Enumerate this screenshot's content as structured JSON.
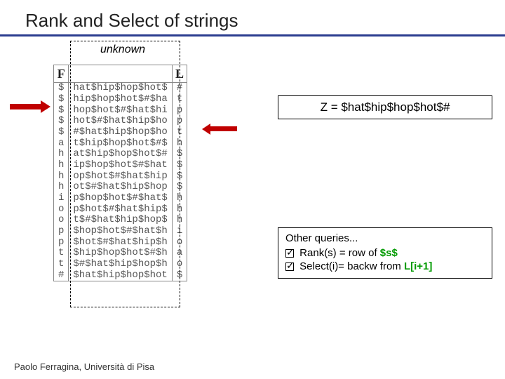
{
  "title": "Rank and Select of strings",
  "unknown_label": "unknown",
  "z_label": "Z = $hat$hip$hop$hot$#",
  "queries": {
    "heading": "Other queries...",
    "rank_prefix": "Rank(s)  = row of ",
    "rank_suffix": "$s$",
    "select_prefix": "Select(i)= backw from ",
    "select_suffix": "L[i+1]"
  },
  "footer": "Paolo Ferragina, Università di Pisa",
  "headers": {
    "F": "F",
    "L": "L"
  },
  "rows": [
    {
      "f": "$",
      "m": "hat$hip$hop$hot$",
      "l": "#"
    },
    {
      "f": "$",
      "m": "hip$hop$hot$#$ha",
      "l": "t"
    },
    {
      "f": "$",
      "m": "hop$hot$#$hat$hi",
      "l": "p"
    },
    {
      "f": "$",
      "m": "hot$#$hat$hip$ho",
      "l": "p"
    },
    {
      "f": "$",
      "m": "#$hat$hip$hop$ho",
      "l": "t"
    },
    {
      "f": "a",
      "m": "t$hip$hop$hot$#$",
      "l": "h"
    },
    {
      "f": "h",
      "m": "at$hip$hop$hot$#",
      "l": "$"
    },
    {
      "f": "h",
      "m": "ip$hop$hot$#$hat",
      "l": "$"
    },
    {
      "f": "h",
      "m": "op$hot$#$hat$hip",
      "l": "$"
    },
    {
      "f": "h",
      "m": "ot$#$hat$hip$hop",
      "l": "$"
    },
    {
      "f": "i",
      "m": "p$hop$hot$#$hat$",
      "l": "h"
    },
    {
      "f": "o",
      "m": "p$hot$#$hat$hip$",
      "l": "h"
    },
    {
      "f": "o",
      "m": "t$#$hat$hip$hop$",
      "l": "h"
    },
    {
      "f": "p",
      "m": "$hop$hot$#$hat$h",
      "l": "i"
    },
    {
      "f": "p",
      "m": "$hot$#$hat$hip$h",
      "l": "o"
    },
    {
      "f": "t",
      "m": "$hip$hop$hot$#$h",
      "l": "a"
    },
    {
      "f": "t",
      "m": "$#$hat$hip$hop$h",
      "l": "o"
    },
    {
      "f": "#",
      "m": "$hat$hip$hop$hot",
      "l": "$"
    }
  ]
}
